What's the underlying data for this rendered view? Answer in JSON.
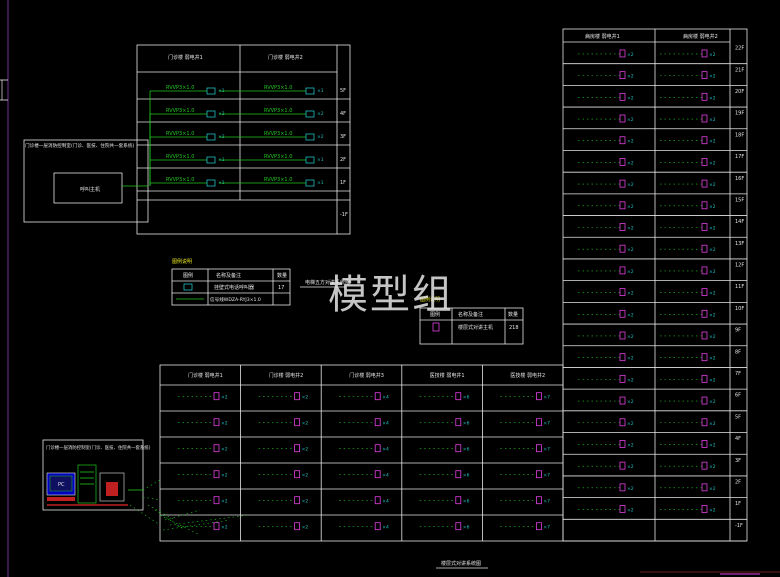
{
  "watermark": "模型组",
  "panel1": {
    "title": "门诊楼一层消防控制室(门诊、医技、住院共一套系统)",
    "host_label": "呼叫主机",
    "col_headers": [
      "门诊楼 弱电井1",
      "门诊楼 弱电井2"
    ],
    "floor_labels": [
      "5F",
      "4F",
      "3F",
      "2F",
      "1F",
      "-1F"
    ],
    "cable_label": "RVVP3×1.0",
    "counts": [
      "×1",
      "×2",
      "×2",
      "×1",
      "×1"
    ]
  },
  "legend1": {
    "title": "图例说明",
    "headers": [
      "图例",
      "名称及备注",
      "数量"
    ],
    "rows": [
      {
        "name": "挂壁式电话呼叫器",
        "qty": "17"
      },
      {
        "name": "信号线WDZA-RYJ3×1.0",
        "qty": ""
      }
    ]
  },
  "system_title1": "电梯五方对讲系统图",
  "legend2": {
    "title": "图例说明",
    "headers": [
      "图例",
      "名称及备注",
      "数量"
    ],
    "rows": [
      {
        "name": "楼层式对讲主机",
        "qty": "218"
      }
    ]
  },
  "right_table": {
    "headers": [
      "病房楼 弱电井1",
      "病房楼 弱电井2"
    ],
    "floors": [
      "22F",
      "21F",
      "20F",
      "19F",
      "18F",
      "17F",
      "16F",
      "15F",
      "14F",
      "13F",
      "12F",
      "11F",
      "10F",
      "9F",
      "8F",
      "7F",
      "6F",
      "5F",
      "4F",
      "3F",
      "2F",
      "1F",
      "-1F"
    ],
    "count": "×2"
  },
  "bottom_table": {
    "headers": [
      "门诊楼 弱电井1",
      "门诊楼 弱电井2",
      "门诊楼 弱电井3",
      "医技楼 弱电井1",
      "医技楼 弱电井2"
    ],
    "rows": [
      [
        "×2",
        "×2",
        "×4",
        "×6",
        "×7"
      ],
      [
        "×2",
        "×2",
        "×4",
        "×6",
        "×7"
      ],
      [
        "×2",
        "×2",
        "×4",
        "×6",
        "×7"
      ],
      [
        "×2",
        "×2",
        "×4",
        "×6",
        "×7"
      ],
      [
        "×2",
        "×2",
        "×4",
        "×6",
        "×7"
      ],
      [
        "×2",
        "×2",
        "×4",
        "×6",
        "×7"
      ]
    ]
  },
  "panel2": {
    "title": "门诊楼一层消防控制室(门诊、医技、住院共一套系统)",
    "pc_label": "PC"
  },
  "system_title2": "楼层式对讲系统图"
}
